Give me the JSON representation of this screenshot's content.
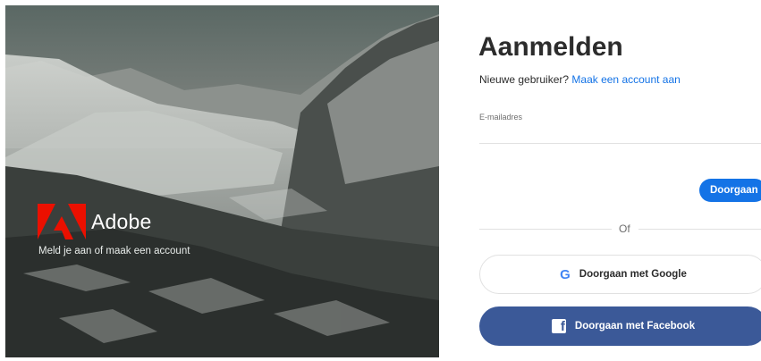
{
  "hero": {
    "brand_name": "Adobe",
    "tagline": "Meld je aan of maak een account"
  },
  "signin": {
    "title": "Aanmelden",
    "new_user_text": "Nieuwe gebruiker?",
    "create_account_link": "Maak een account aan",
    "email_label": "E-mailadres",
    "email_value": "",
    "continue_button": "Doorgaan",
    "or_text": "Of",
    "google_icon": "G",
    "google_button": "Doorgaan met Google",
    "facebook_icon": "f",
    "facebook_button": "Doorgaan met Facebook"
  },
  "colors": {
    "accent": "#1473e6",
    "facebook": "#3b5998",
    "adobe_red": "#eb1000"
  },
  "icons": [
    "adobe-logo-icon",
    "google-icon",
    "facebook-icon"
  ]
}
